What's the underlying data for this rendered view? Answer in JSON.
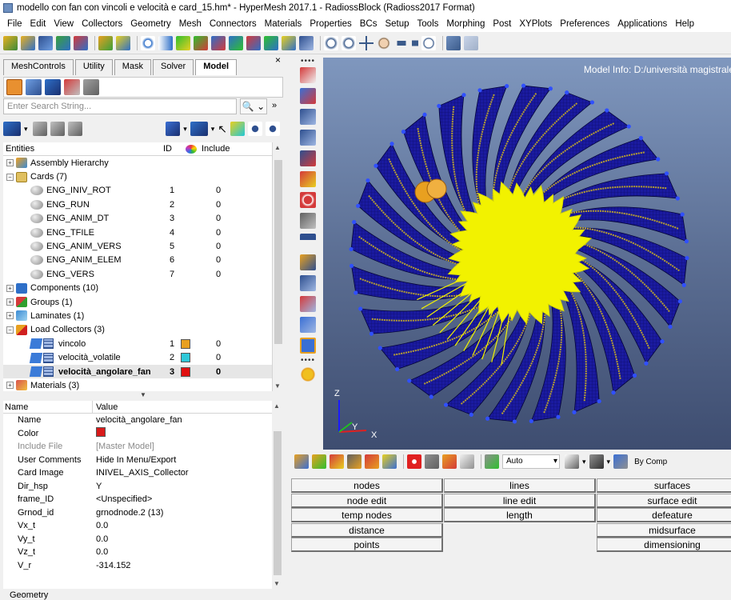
{
  "window": {
    "title": "modello con fan con vincoli e velocità e card_15.hm* - HyperMesh 2017.1 - RadiossBlock (Radioss2017 Format)"
  },
  "menu": [
    "File",
    "Edit",
    "View",
    "Collectors",
    "Geometry",
    "Mesh",
    "Connectors",
    "Materials",
    "Properties",
    "BCs",
    "Setup",
    "Tools",
    "Morphing",
    "Post",
    "XYPlots",
    "Preferences",
    "Applications",
    "Help"
  ],
  "left_panel": {
    "close": "×",
    "tabs": [
      {
        "label": "MeshControls",
        "active": false
      },
      {
        "label": "Utility",
        "active": false
      },
      {
        "label": "Mask",
        "active": false
      },
      {
        "label": "Solver",
        "active": false
      },
      {
        "label": "Model",
        "active": true
      }
    ],
    "search_placeholder": "Enter Search String...",
    "search_button": "🔍 ⌄",
    "more": "»"
  },
  "entities": {
    "headers": {
      "entities": "Entities",
      "id": "ID",
      "include": "Include"
    },
    "rows": [
      {
        "label": "Assembly Hierarchy",
        "expander": "+",
        "icon": "assembly-icon",
        "level": 0
      },
      {
        "label": "Cards (7)",
        "expander": "−",
        "icon": "cards-folder-icon",
        "level": 0
      },
      {
        "label": "ENG_INIV_ROT",
        "id": "1",
        "include": "0",
        "icon": "card-icon",
        "level": 2
      },
      {
        "label": "ENG_RUN",
        "id": "2",
        "include": "0",
        "icon": "card-icon",
        "level": 2
      },
      {
        "label": "ENG_ANIM_DT",
        "id": "3",
        "include": "0",
        "icon": "card-icon",
        "level": 2
      },
      {
        "label": "ENG_TFILE",
        "id": "4",
        "include": "0",
        "icon": "card-icon",
        "level": 2
      },
      {
        "label": "ENG_ANIM_VERS",
        "id": "5",
        "include": "0",
        "icon": "card-icon",
        "level": 2
      },
      {
        "label": "ENG_ANIM_ELEM",
        "id": "6",
        "include": "0",
        "icon": "card-icon",
        "level": 2
      },
      {
        "label": "ENG_VERS",
        "id": "7",
        "include": "0",
        "icon": "card-icon",
        "level": 2
      },
      {
        "label": "Components (10)",
        "expander": "+",
        "icon": "components-icon",
        "level": 0
      },
      {
        "label": "Groups (1)",
        "expander": "+",
        "icon": "groups-icon",
        "level": 0
      },
      {
        "label": "Laminates (1)",
        "expander": "+",
        "icon": "laminates-icon",
        "level": 0
      },
      {
        "label": "Load Collectors (3)",
        "expander": "−",
        "icon": "load-collectors-icon",
        "level": 0
      },
      {
        "label": "vincolo",
        "id": "1",
        "include": "0",
        "color": "#e8a020",
        "icon": "load-collector-icon",
        "level": 2
      },
      {
        "label": "velocità_volatile",
        "id": "2",
        "include": "0",
        "color": "#30c8d8",
        "icon": "load-collector-icon",
        "level": 2
      },
      {
        "label": "velocità_angolare_fan",
        "id": "3",
        "include": "0",
        "color": "#e01010",
        "icon": "load-collector-icon",
        "level": 2,
        "selected": true
      },
      {
        "label": "Materials (3)",
        "expander": "+",
        "icon": "materials-icon",
        "level": 0
      }
    ]
  },
  "properties": {
    "headers": {
      "name": "Name",
      "value": "Value"
    },
    "rows": [
      {
        "name": "Name",
        "value": "velocità_angolare_fan"
      },
      {
        "name": "Color",
        "value": "",
        "color": "#d81a1a"
      },
      {
        "name": "Include File",
        "value": "[Master Model]",
        "muted": true
      },
      {
        "name": "User Comments",
        "value": "Hide In Menu/Export"
      },
      {
        "name": "Card Image",
        "value": "INIVEL_AXIS_Collector"
      },
      {
        "name": "Dir_hsp",
        "value": "Y"
      },
      {
        "name": "frame_ID",
        "value": "<Unspecified>"
      },
      {
        "name": "Grnod_id",
        "value": "grnodnode.2 (13)"
      },
      {
        "name": "Vx_t",
        "value": "0.0"
      },
      {
        "name": "Vy_t",
        "value": "0.0"
      },
      {
        "name": "Vz_t",
        "value": "0.0"
      },
      {
        "name": "V_r",
        "value": "-314.152"
      }
    ]
  },
  "viewport": {
    "model_info": "Model Info: D:/università magistrale",
    "axis": {
      "z": "Z",
      "y": "Y",
      "x": "X"
    },
    "colors": {
      "mesh": "#1a1aa0",
      "center": "#f2f200",
      "marker": "#e8a020"
    }
  },
  "bottom_toolbar": {
    "auto": "Auto",
    "by_comp": "By Comp"
  },
  "panels": {
    "col1": [
      "nodes",
      "node edit",
      "temp nodes",
      "distance",
      "points"
    ],
    "col2": [
      "lines",
      "line edit",
      "length"
    ],
    "col3": [
      "surfaces",
      "surface edit",
      "defeature",
      "midsurface",
      "dimensioning"
    ]
  },
  "status": {
    "text": "Geometry"
  }
}
